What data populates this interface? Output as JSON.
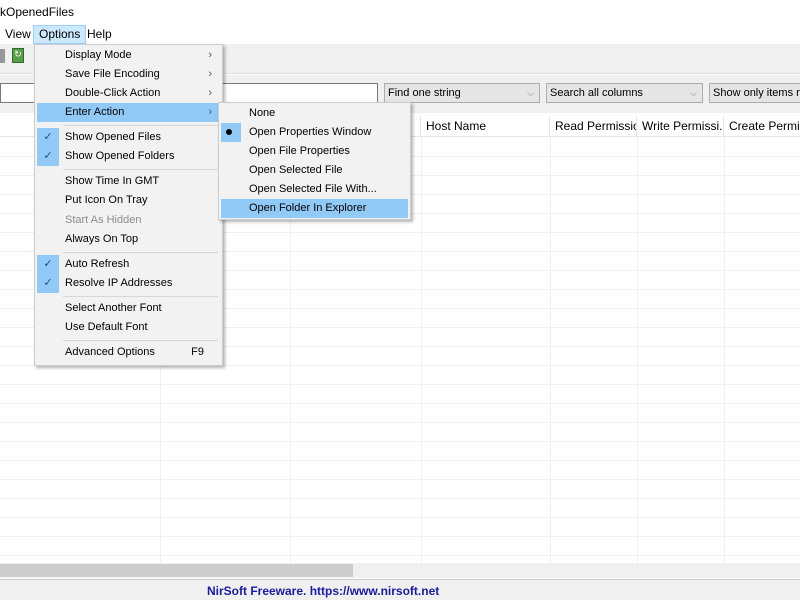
{
  "window": {
    "title": "kOpenedFiles"
  },
  "menubar": [
    {
      "label": "View"
    },
    {
      "label": "Options"
    },
    {
      "label": "Help"
    }
  ],
  "filter": {
    "input_value": "",
    "find_mode": "Find one string",
    "column_mode": "Search all columns",
    "show_mode": "Show only items matc"
  },
  "columns": [
    "Host Name",
    "Read Permission",
    "Write Permissi...",
    "Create Permiss..."
  ],
  "options_menu": [
    {
      "label": "Display Mode",
      "submenu": true
    },
    {
      "label": "Save File Encoding",
      "submenu": true
    },
    {
      "label": "Double-Click Action",
      "submenu": true
    },
    {
      "label": "Enter Action",
      "submenu": true,
      "highlighted": true
    },
    {
      "label": "Show Opened Files",
      "checked": true
    },
    {
      "label": "Show Opened Folders",
      "checked": true
    },
    {
      "label": "Show Time In GMT"
    },
    {
      "label": "Put Icon On Tray"
    },
    {
      "label": "Start As Hidden",
      "disabled": true
    },
    {
      "label": "Always On Top"
    },
    {
      "label": "Auto Refresh",
      "checked": true
    },
    {
      "label": "Resolve IP Addresses",
      "checked": true
    },
    {
      "label": "Select Another Font"
    },
    {
      "label": "Use Default Font"
    },
    {
      "label": "Advanced Options",
      "shortcut": "F9"
    }
  ],
  "enter_action_submenu": [
    {
      "label": "None"
    },
    {
      "label": "Open Properties Window",
      "selected": true
    },
    {
      "label": "Open File Properties"
    },
    {
      "label": "Open Selected File"
    },
    {
      "label": "Open Selected File With..."
    },
    {
      "label": "Open Folder In Explorer",
      "highlighted": true
    }
  ],
  "status": {
    "text": "NirSoft Freeware. https://www.nirsoft.net"
  },
  "colors": {
    "menu_highlight": "#91c9f7",
    "status_text": "#1a1aa6"
  }
}
